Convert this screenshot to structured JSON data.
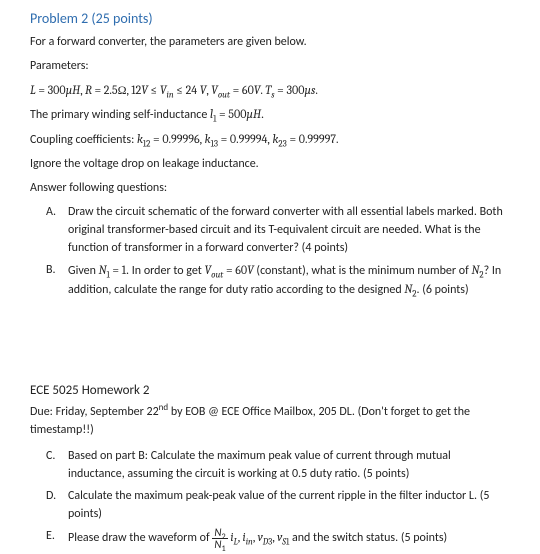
{
  "problem": {
    "title": "Problem 2 (25 points)",
    "intro": "For a forward converter, the parameters are given below.",
    "params_label": "Parameters:",
    "params_line": "L = 300µH, R = 2.5Ω, 12V ≤ V_in ≤ 24 V, V_out = 60V. T_s = 300µs.",
    "self_ind": "The primary winding self-inductance l₁ = 500µH.",
    "coupling": "Coupling coefficients: k₁₂ = 0.99996, k₁₃ = 0.99994, k₂₃ = 0.99997.",
    "ignore": "Ignore the voltage drop on leakage inductance.",
    "answer_following": "Answer following questions:",
    "items": {
      "A": "Draw the circuit schematic of the forward converter with all essential labels marked. Both original transformer-based circuit and its T-equivalent circuit are needed. What is the function of transformer in a forward converter? (4 points)",
      "B": "Given N₁ = 1. In order to get V_out = 60V (constant), what is the minimum number of N₂? In addition, calculate the range for duty ratio according to the designed N₂. (6 points)"
    }
  },
  "footer": {
    "course": "ECE 5025 Homework 2",
    "due": "Due: Friday, September 22ⁿᵈ by EOB @ ECE Office Mailbox, 205 DL. (Don't forget to get the timestamp!!)",
    "items": {
      "C": "Based on part B: Calculate the maximum peak value of current through mutual inductance, assuming the circuit is working at 0.5 duty ratio. (5 points)",
      "D": "Calculate the maximum peak-peak value of the current ripple in the filter inductor L. (5 points)",
      "E_prefix": "Please draw the waveform of ",
      "E_suffix": " and the switch status. (5 points)",
      "E_symbols": "N₂/N₁ · i_L, i_in, v_D3, v_S1"
    }
  }
}
